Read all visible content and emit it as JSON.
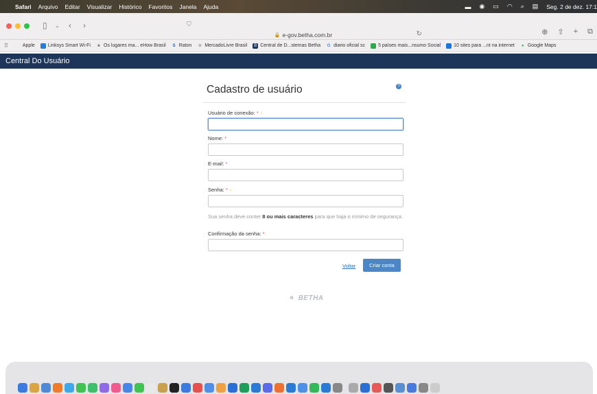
{
  "menubar": {
    "app": "Safari",
    "items": [
      "Arquivo",
      "Editar",
      "Visualizar",
      "Histórico",
      "Favoritos",
      "Janela",
      "Ajuda"
    ],
    "clock": "Seg. 2 de dez. 17:1"
  },
  "browser": {
    "url": "e-gov.betha.com.br"
  },
  "bookmarks": [
    {
      "label": "Apple",
      "color": "#333333"
    },
    {
      "label": "Linksys Smart Wi-Fi",
      "color": "#2a7bd6"
    },
    {
      "label": "Os lugares ma... eHow Brasil",
      "color": "#222222"
    },
    {
      "label": "Raton",
      "color": "#2a5fb0"
    },
    {
      "label": "MercadoLivre Brasil",
      "color": "#888888"
    },
    {
      "label": "Central de D...stemas Betha",
      "color": "#1d3559"
    },
    {
      "label": "diario oficial sc",
      "color": "#4285f4"
    },
    {
      "label": "5 países mais...nsumo Social",
      "color": "#2fa84f"
    },
    {
      "label": "10 sites para ...nt na internet",
      "color": "#1a73e8"
    },
    {
      "label": "Google Maps",
      "color": "#34a853"
    }
  ],
  "site": {
    "header_title": "Central Do Usuário"
  },
  "form": {
    "title": "Cadastro de usuário",
    "fields": {
      "usuario": {
        "label": "Usuário de conexão:",
        "required": "*"
      },
      "nome": {
        "label": "Nome:",
        "required": "*"
      },
      "email": {
        "label": "E-mail:",
        "required": "*"
      },
      "senha": {
        "label": "Senha:",
        "required": "*"
      },
      "confirmacao": {
        "label": "Confirmação da senha:",
        "required": "*"
      }
    },
    "hint": {
      "pre": "Sua senha deve conter ",
      "bold": "8 ou mais caracteres",
      "post": " para que haja o mínimo de segurança."
    },
    "voltar_label": "Voltar",
    "criar_label": "Criar conta"
  },
  "footer": {
    "brand": "BETHA"
  },
  "colors": {
    "header_bg": "#1d3559",
    "primary_button": "#4a86c8",
    "link": "#2a6ebb",
    "required": "#d9534f"
  },
  "dock_colors": [
    "#3b7ae0",
    "#d9a441",
    "#4f8ad8",
    "#f07b2a",
    "#3fa8e8",
    "#3fc454",
    "#3ec06a",
    "#8e6ae8",
    "#f05a8c",
    "#4a86e8",
    "#3fc454",
    "#e8e8e8",
    "#c8a050",
    "#222222",
    "#3a7be0",
    "#e84f4f",
    "#4f8fe8",
    "#f0a040",
    "#2a6ed6",
    "#1e9e5a",
    "#2a7bd6",
    "#5a6ae8",
    "#f07030",
    "#2a7bd6",
    "#4f8fe8",
    "#34b85a",
    "#2a7bd6",
    "#888888",
    "#aaaaaa",
    "#2a6ed6",
    "#e85a5a",
    "#555555",
    "#5a8fcf",
    "#4a7ae0",
    "#888888",
    "#cccccc"
  ]
}
